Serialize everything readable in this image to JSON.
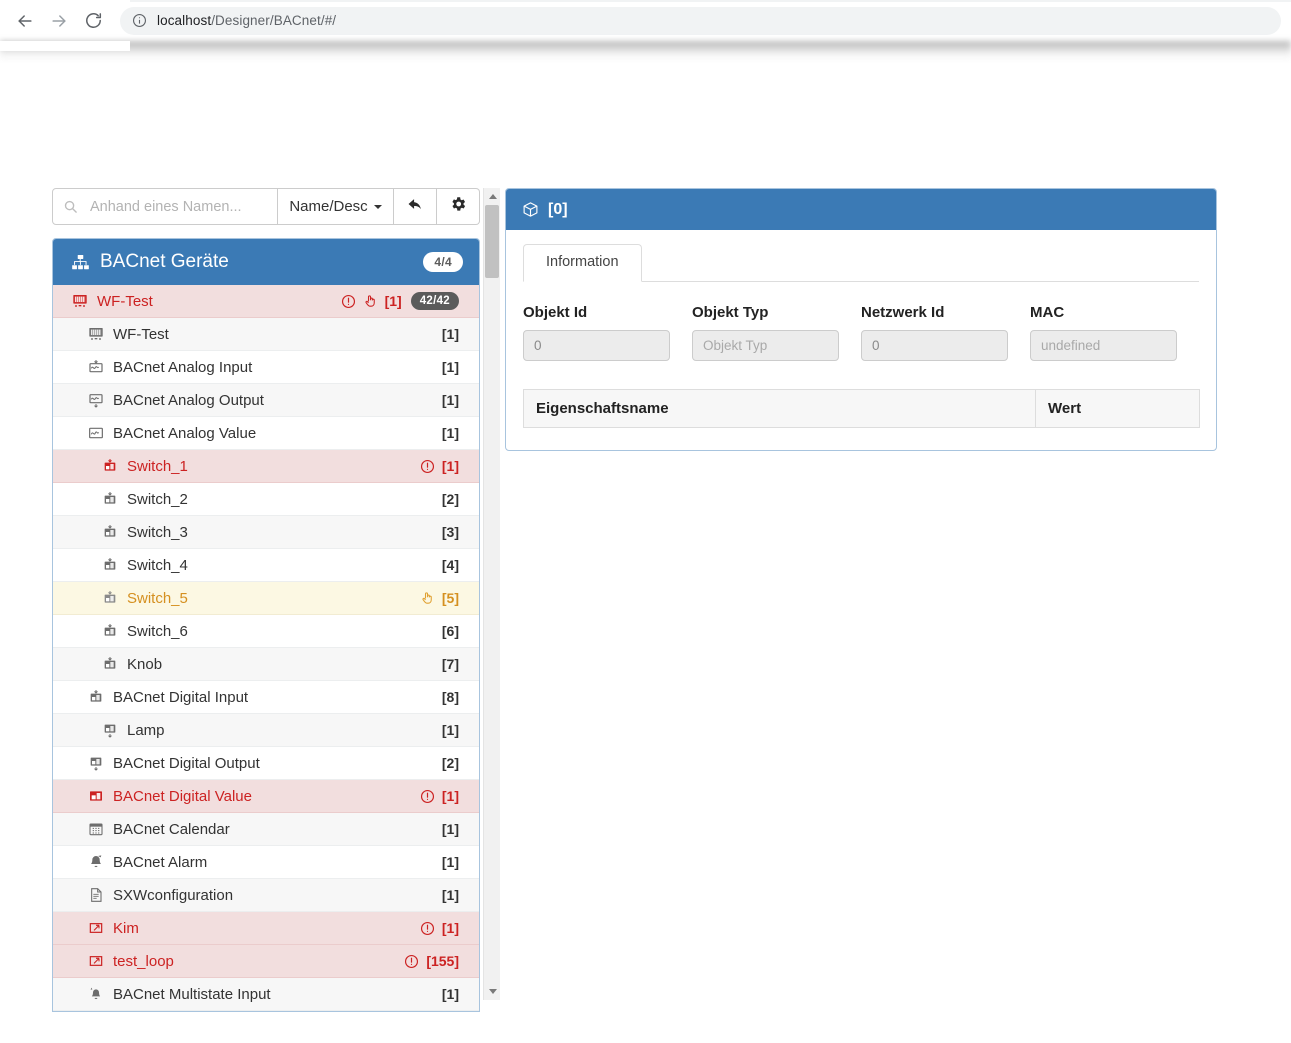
{
  "browser": {
    "url_prefix": "localhost",
    "url_rest": "/Designer/BACnet/#/",
    "back_icon": "back-arrow-icon",
    "forward_icon": "forward-arrow-icon",
    "reload_icon": "reload-icon",
    "site_info_icon": "info-circle-icon"
  },
  "toolbar": {
    "search_placeholder": "Anhand eines Namen...",
    "search_value": "",
    "search_icon": "search-icon",
    "sort_label": "Name/Desc",
    "undo_icon": "undo-arrow-icon",
    "gear_icon": "gear-icon"
  },
  "tree": {
    "header": {
      "title": "BACnet Geräte",
      "badge": "4/4",
      "icon": "sitemap-icon"
    },
    "rows": [
      {
        "label": "WF-Test",
        "count": "[1]",
        "badge": "42/42",
        "icon": "device-icon",
        "state": "danger",
        "indent": 0,
        "warn": true,
        "hand": true
      },
      {
        "label": "WF-Test",
        "count": "[1]",
        "badge": "",
        "icon": "device-icon",
        "state": "striped",
        "indent": 1,
        "warn": false,
        "hand": false
      },
      {
        "label": "BACnet Analog Input",
        "count": "[1]",
        "badge": "",
        "icon": "analog-input-icon",
        "state": "normal",
        "indent": 1,
        "warn": false,
        "hand": false
      },
      {
        "label": "BACnet Analog Output",
        "count": "[1]",
        "badge": "",
        "icon": "analog-output-icon",
        "state": "striped",
        "indent": 1,
        "warn": false,
        "hand": false
      },
      {
        "label": "BACnet Analog Value",
        "count": "[1]",
        "badge": "",
        "icon": "analog-value-icon",
        "state": "normal",
        "indent": 1,
        "warn": false,
        "hand": false
      },
      {
        "label": "Switch_1",
        "count": "[1]",
        "badge": "",
        "icon": "digital-input-icon",
        "state": "danger",
        "indent": 2,
        "warn": true,
        "hand": false
      },
      {
        "label": "Switch_2",
        "count": "[2]",
        "badge": "",
        "icon": "digital-input-icon",
        "state": "normal",
        "indent": 2,
        "warn": false,
        "hand": false
      },
      {
        "label": "Switch_3",
        "count": "[3]",
        "badge": "",
        "icon": "digital-input-icon",
        "state": "striped",
        "indent": 2,
        "warn": false,
        "hand": false
      },
      {
        "label": "Switch_4",
        "count": "[4]",
        "badge": "",
        "icon": "digital-input-icon",
        "state": "normal",
        "indent": 2,
        "warn": false,
        "hand": false
      },
      {
        "label": "Switch_5",
        "count": "[5]",
        "badge": "",
        "icon": "digital-input-icon",
        "state": "warning",
        "indent": 2,
        "warn": false,
        "hand": true
      },
      {
        "label": "Switch_6",
        "count": "[6]",
        "badge": "",
        "icon": "digital-input-icon",
        "state": "normal",
        "indent": 2,
        "warn": false,
        "hand": false
      },
      {
        "label": "Knob",
        "count": "[7]",
        "badge": "",
        "icon": "digital-input-icon",
        "state": "striped",
        "indent": 2,
        "warn": false,
        "hand": false
      },
      {
        "label": "BACnet Digital Input",
        "count": "[8]",
        "badge": "",
        "icon": "digital-input-icon",
        "state": "normal",
        "indent": 1,
        "warn": false,
        "hand": false
      },
      {
        "label": "Lamp",
        "count": "[1]",
        "badge": "",
        "icon": "digital-output-icon",
        "state": "striped",
        "indent": 2,
        "warn": false,
        "hand": false
      },
      {
        "label": "BACnet Digital Output",
        "count": "[2]",
        "badge": "",
        "icon": "digital-output-icon",
        "state": "normal",
        "indent": 1,
        "warn": false,
        "hand": false
      },
      {
        "label": "BACnet Digital Value",
        "count": "[1]",
        "badge": "",
        "icon": "digital-value-icon",
        "state": "danger",
        "indent": 1,
        "warn": true,
        "hand": false
      },
      {
        "label": "BACnet Calendar",
        "count": "[1]",
        "badge": "",
        "icon": "calendar-icon",
        "state": "striped",
        "indent": 1,
        "warn": false,
        "hand": false
      },
      {
        "label": "BACnet Alarm",
        "count": "[1]",
        "badge": "",
        "icon": "alarm-bell-icon",
        "state": "normal",
        "indent": 1,
        "warn": false,
        "hand": false
      },
      {
        "label": "SXWconfiguration",
        "count": "[1]",
        "badge": "",
        "icon": "document-icon",
        "state": "striped",
        "indent": 1,
        "warn": false,
        "hand": false
      },
      {
        "label": "Kim",
        "count": "[1]",
        "badge": "",
        "icon": "loop-icon",
        "state": "danger",
        "indent": 1,
        "warn": true,
        "hand": false
      },
      {
        "label": "test_loop",
        "count": "[155]",
        "badge": "",
        "icon": "loop-icon",
        "state": "danger",
        "indent": 1,
        "warn": true,
        "hand": false
      },
      {
        "label": "BACnet Multistate Input",
        "count": "[1]",
        "badge": "",
        "icon": "multistate-input-icon",
        "state": "striped",
        "indent": 1,
        "warn": false,
        "hand": false
      }
    ]
  },
  "detail": {
    "header_title": "[0]",
    "header_icon": "cube-icon",
    "tabs": [
      {
        "label": "Information",
        "active": true
      }
    ],
    "fields": [
      {
        "label": "Objekt Id",
        "value": "0",
        "placeholder": ""
      },
      {
        "label": "Objekt Typ",
        "value": "",
        "placeholder": "Objekt Typ"
      },
      {
        "label": "Netzwerk Id",
        "value": "0",
        "placeholder": ""
      },
      {
        "label": "MAC",
        "value": "",
        "placeholder": "undefined"
      }
    ],
    "table": {
      "columns": [
        "Eigenschaftsname",
        "Wert"
      ],
      "rows": []
    }
  },
  "colors": {
    "primary": "#3b7ab5",
    "danger_bg": "#f2dede",
    "danger_text": "#cc2222",
    "warning_bg": "#fcf8e3",
    "warning_text": "#d59020",
    "panel_border": "#a8c4de"
  }
}
